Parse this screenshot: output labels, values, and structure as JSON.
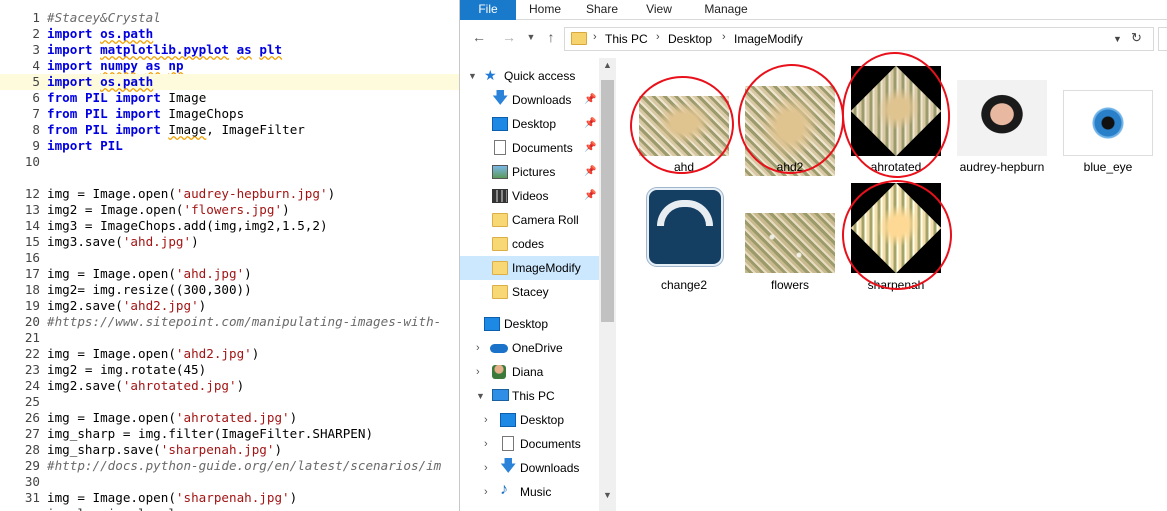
{
  "editor": {
    "lines": [
      {
        "n": "1",
        "html": "<span class='cm'>#Stacey&amp;Crystal</span>"
      },
      {
        "n": "2",
        "html": "<span class='kw'>import</span> <span class='mod sq'>os.path</span>"
      },
      {
        "n": "3",
        "html": "<span class='kw'>import</span> <span class='mod sq'>matplotlib.pyplot</span> <span class='kw sq'>as</span> <span class='mod sq'>plt</span>"
      },
      {
        "n": "4",
        "html": "<span class='kw'>import</span> <span class='mod sq'>numpy</span> <span class='kw sq'>as</span> <span class='mod sq'>np</span>"
      },
      {
        "n": "5",
        "html": "<span class='kw'>import</span> <span class='mod sq'>os.path</span>",
        "hl": true
      },
      {
        "n": "6",
        "html": "<span class='kw'>from</span> <span class='mod'>PIL</span> <span class='kw'>import</span> Image"
      },
      {
        "n": "7",
        "html": "<span class='kw'>from</span> <span class='mod'>PIL</span> <span class='kw'>import</span> ImageChops"
      },
      {
        "n": "8",
        "html": "<span class='kw'>from</span> <span class='mod'>PIL</span> <span class='kw'>import</span> <span class='sq'>Image</span>, ImageFilter"
      },
      {
        "n": "9",
        "html": "<span class='kw'>import</span> <span class='mod'>PIL</span>"
      },
      {
        "n": "10",
        "html": ""
      },
      {
        "n": "",
        "html": ""
      },
      {
        "n": "12",
        "html": "img = Image.open(<span class='st'>'audrey-hepburn.jpg'</span>)"
      },
      {
        "n": "13",
        "html": "img2 = Image.open(<span class='st'>'flowers.jpg'</span>)"
      },
      {
        "n": "14",
        "html": "img3 = ImageChops.add(img,img2,1.5,2)"
      },
      {
        "n": "15",
        "html": "img3.save(<span class='st'>'ahd.jpg'</span>)"
      },
      {
        "n": "16",
        "html": ""
      },
      {
        "n": "17",
        "html": "img = Image.open(<span class='st'>'ahd.jpg'</span>)"
      },
      {
        "n": "18",
        "html": "img2= img.resize((300,300))"
      },
      {
        "n": "19",
        "html": "img2.save(<span class='st'>'ahd2.jpg'</span>)"
      },
      {
        "n": "20",
        "html": "<span class='cm'>#https://www.sitepoint.com/manipulating-images-with-</span>"
      },
      {
        "n": "21",
        "html": ""
      },
      {
        "n": "22",
        "html": "img = Image.open(<span class='st'>'ahd2.jpg'</span>)"
      },
      {
        "n": "23",
        "html": "img2 = img.rotate(45)"
      },
      {
        "n": "24",
        "html": "img2.save(<span class='st'>'ahrotated.jpg'</span>)"
      },
      {
        "n": "25",
        "html": ""
      },
      {
        "n": "26",
        "html": "img = Image.open(<span class='st'>'ahrotated.jpg'</span>)"
      },
      {
        "n": "27",
        "html": "img_sharp = img.filter(ImageFilter.SHARPEN)"
      },
      {
        "n": "28",
        "html": "img_sharp.save(<span class='st'>'sharpenah.jpg'</span>)"
      },
      {
        "n": "29",
        "html": "<span class='cm'>#http://docs.python-guide.org/en/latest/scenarios/im</span>"
      },
      {
        "n": "30",
        "html": ""
      },
      {
        "n": "31",
        "html": "img = Image.open(<span class='st'>'sharpenah.jpg'</span>)"
      },
      {
        "n": "",
        "html": "<span class='nm'>i   l   i   l   l</span>"
      }
    ]
  },
  "explorer": {
    "ribbon": {
      "file": "File",
      "home": "Home",
      "share": "Share",
      "view": "View",
      "manage": "Manage"
    },
    "address": {
      "crumbs": [
        "This PC",
        "Desktop",
        "ImageModify"
      ]
    },
    "nav": {
      "quick_access": "Quick access",
      "downloads": "Downloads",
      "desktop": "Desktop",
      "documents": "Documents",
      "pictures": "Pictures",
      "videos": "Videos",
      "camera_roll": "Camera Roll",
      "codes": "codes",
      "imagemodify": "ImageModify",
      "stacey": "Stacey",
      "desktop2": "Desktop",
      "onedrive": "OneDrive",
      "diana": "Diana",
      "this_pc": "This PC",
      "pc_desktop": "Desktop",
      "pc_documents": "Documents",
      "pc_downloads": "Downloads",
      "pc_music": "Music"
    },
    "files": {
      "ahd": "ahd",
      "ahd2": "ahd2",
      "ahrotated": "ahrotated",
      "audrey": "audrey-hepburn",
      "blue_eye": "blue_eye",
      "change2": "change2",
      "flowers": "flowers",
      "sharpenah": "sharpenah"
    }
  }
}
